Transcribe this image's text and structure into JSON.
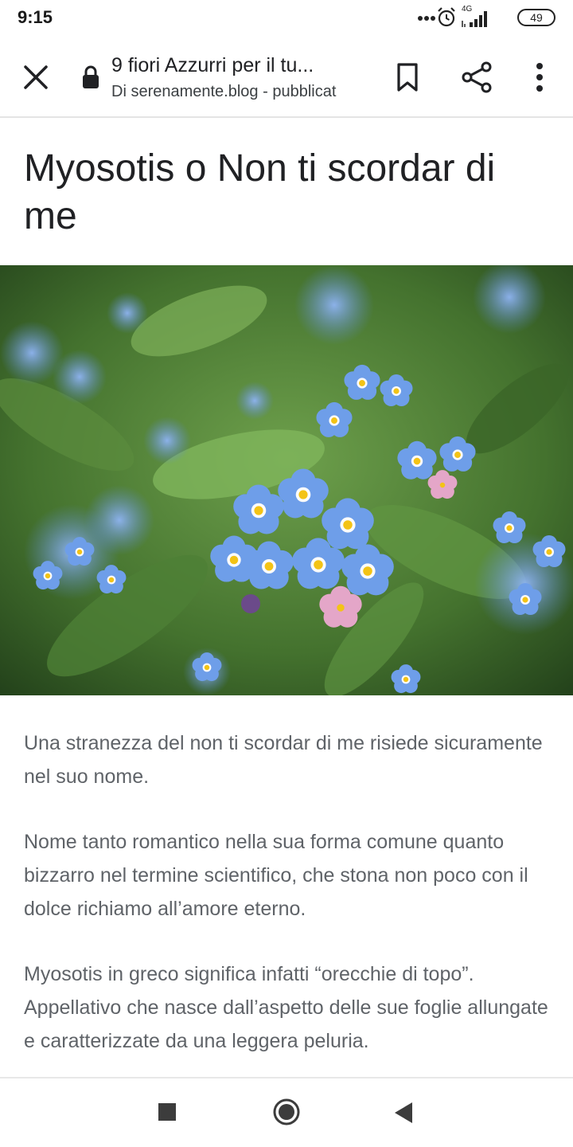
{
  "status_bar": {
    "time": "9:15",
    "network": "4G",
    "battery": "49",
    "icons": [
      "more-dots-icon",
      "alarm-icon",
      "signal-icon",
      "battery-icon"
    ]
  },
  "top_bar": {
    "title": "9 fiori Azzurri per il tu...",
    "subtitle": "Di serenamente.blog - pubblicat",
    "icons": [
      "close-icon",
      "lock-icon",
      "bookmark-icon",
      "share-icon",
      "more-vert-icon"
    ]
  },
  "article": {
    "heading": "Myosotis o Non ti scordar di me",
    "image": "forget-me-not-flowers-photo",
    "paragraphs": [
      "Una stranezza del non ti scordar di me risiede sicuramente nel suo nome.",
      "Nome tanto romantico nella sua forma comune quanto bizzarro nel termine scientifico, che stona non poco con il dolce richiamo all’amore eterno.",
      "Myosotis in greco significa infatti “orecchie di topo”. Appellativo che nasce dall’aspetto delle sue foglie allungate e caratterizzate da una leggera peluria."
    ]
  },
  "nav_bar": {
    "icons": [
      "recents-square-icon",
      "home-circle-icon",
      "back-triangle-icon"
    ]
  },
  "colors": {
    "text_dark": "#202124",
    "text_body": "#5f6368",
    "divider": "#e4e4e4",
    "flower_blue": "#6b9be8",
    "flower_center": "#f3c316",
    "leaf_green": "#4a7d35"
  }
}
